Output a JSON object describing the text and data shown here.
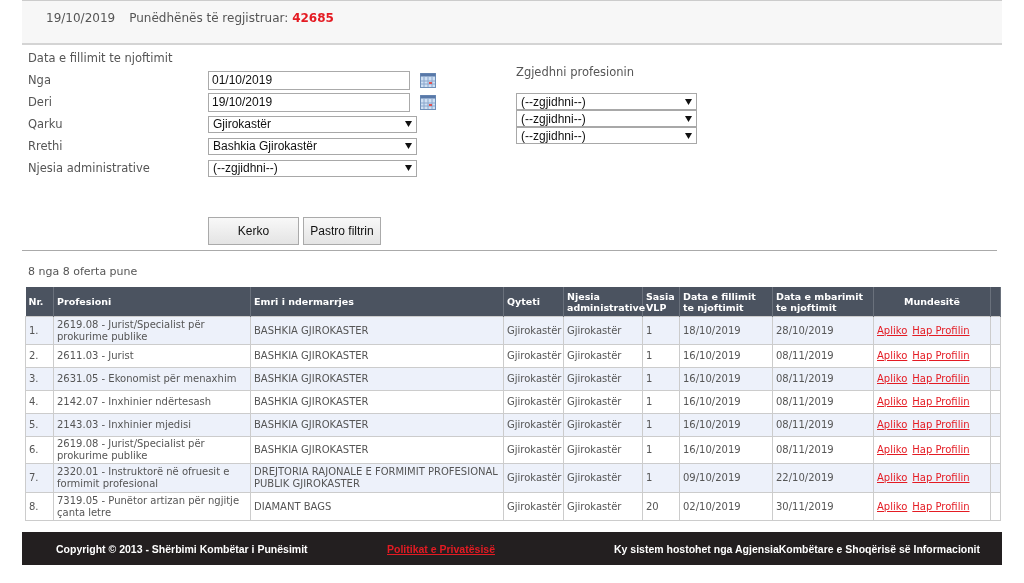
{
  "header": {
    "date": "19/10/2019",
    "registered_label": "Punëdhënës të regjistruar:",
    "registered_count": "42685"
  },
  "filter": {
    "title": "Data e fillimit te njoftimit",
    "fields": [
      {
        "label": "Nga",
        "kind": "date",
        "value": "01/10/2019"
      },
      {
        "label": "Deri",
        "kind": "date",
        "value": "19/10/2019"
      },
      {
        "label": "Qarku",
        "kind": "select",
        "value": "Gjirokastër"
      },
      {
        "label": "Rrethi",
        "kind": "select",
        "value": "Bashkia Gjirokastër"
      },
      {
        "label": "Njesia administrative",
        "kind": "select",
        "value": "(--zgjidhni--)"
      }
    ],
    "profession": {
      "label": "Zgjedhni profesionin",
      "selects": [
        "(--zgjidhni--)",
        "(--zgjidhni--)",
        "(--zgjidhni--)"
      ]
    },
    "buttons": [
      "Kerko",
      "Pastro filtrin"
    ]
  },
  "results_count": "8 nga 8 oferta pune",
  "table": {
    "columns": [
      "Nr.",
      "Profesioni",
      "Emri i ndermarrjes",
      "Qyteti",
      "Njesia administrative",
      "Sasia VLP",
      "Data e fillimit te njoftimit",
      "Data e mbarimit te njoftimit",
      "Mundesitë"
    ],
    "rows": [
      {
        "cells": [
          "1.",
          "2619.08 - Jurist/Specialist për prokurime publike",
          "BASHKIA GJIROKASTER",
          "Gjirokastër",
          "Gjirokastër",
          "1",
          "18/10/2019",
          "28/10/2019"
        ],
        "actions": [
          "Apliko",
          "Hap Profilin"
        ]
      },
      {
        "cells": [
          "2.",
          "2611.03 - Jurist",
          "BASHKIA GJIROKASTER",
          "Gjirokastër",
          "Gjirokastër",
          "1",
          "16/10/2019",
          "08/11/2019"
        ],
        "actions": [
          "Apliko",
          "Hap Profilin"
        ]
      },
      {
        "cells": [
          "3.",
          "2631.05 - Ekonomist për menaxhim",
          "BASHKIA GJIROKASTER",
          "Gjirokastër",
          "Gjirokastër",
          "1",
          "16/10/2019",
          "08/11/2019"
        ],
        "actions": [
          "Apliko",
          "Hap Profilin"
        ]
      },
      {
        "cells": [
          "4.",
          "2142.07 - Inxhinier ndërtesash",
          "BASHKIA GJIROKASTER",
          "Gjirokastër",
          "Gjirokastër",
          "1",
          "16/10/2019",
          "08/11/2019"
        ],
        "actions": [
          "Apliko",
          "Hap Profilin"
        ]
      },
      {
        "cells": [
          "5.",
          "2143.03 - Inxhinier mjedisi",
          "BASHKIA GJIROKASTER",
          "Gjirokastër",
          "Gjirokastër",
          "1",
          "16/10/2019",
          "08/11/2019"
        ],
        "actions": [
          "Apliko",
          "Hap Profilin"
        ]
      },
      {
        "cells": [
          "6.",
          "2619.08 - Jurist/Specialist për prokurime publike",
          "BASHKIA GJIROKASTER",
          "Gjirokastër",
          "Gjirokastër",
          "1",
          "16/10/2019",
          "08/11/2019"
        ],
        "actions": [
          "Apliko",
          "Hap Profilin"
        ]
      },
      {
        "cells": [
          "7.",
          "2320.01 - Instruktorë në ofruesit e formimit profesional",
          "DREJTORIA RAJONALE E FORMIMIT PROFESIONAL PUBLIK GJIROKASTER",
          "Gjirokastër",
          "Gjirokastër",
          "1",
          "09/10/2019",
          "22/10/2019"
        ],
        "actions": [
          "Apliko",
          "Hap Profilin"
        ]
      },
      {
        "cells": [
          "8.",
          "7319.05 - Punëtor artizan për ngjitje çanta letre",
          "DIAMANT BAGS",
          "Gjirokastër",
          "Gjirokastër",
          "20",
          "02/10/2019",
          "30/11/2019"
        ],
        "actions": [
          "Apliko",
          "Hap Profilin"
        ]
      }
    ]
  },
  "footer": {
    "copyright": "Copyright © 2013 - Shërbimi Kombëtar i Punësimit",
    "privacy_link": "Politikat e Privatësisë",
    "hosting": "Ky sistem hostohet nga AgjensiaKombëtare e Shoqërisë së Informacionit"
  }
}
